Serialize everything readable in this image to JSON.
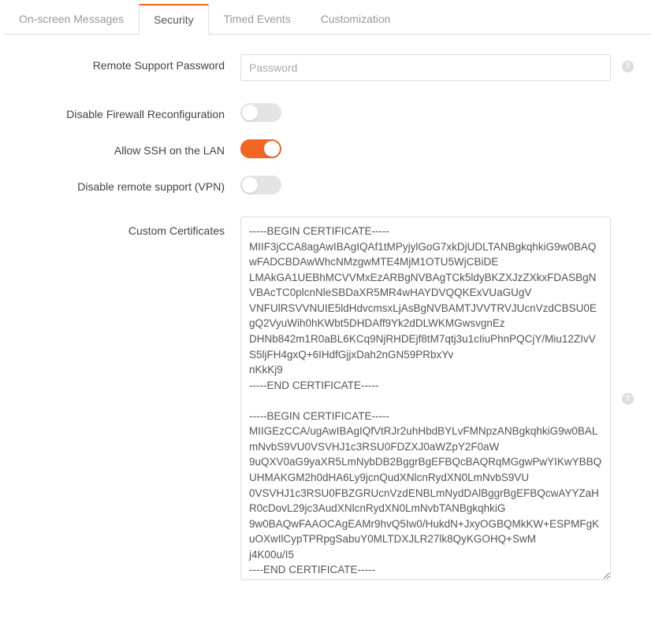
{
  "tabs": [
    {
      "label": "On-screen Messages",
      "active": false
    },
    {
      "label": "Security",
      "active": true
    },
    {
      "label": "Timed Events",
      "active": false
    },
    {
      "label": "Customization",
      "active": false
    }
  ],
  "fields": {
    "remote_password": {
      "label": "Remote Support Password",
      "placeholder": "Password",
      "value": ""
    },
    "disable_firewall": {
      "label": "Disable Firewall Reconfiguration",
      "on": false
    },
    "allow_ssh": {
      "label": "Allow SSH on the LAN",
      "on": true
    },
    "disable_vpn": {
      "label": "Disable remote support (VPN)",
      "on": false
    },
    "custom_certs": {
      "label": "Custom Certificates",
      "value": "-----BEGIN CERTIFICATE-----\nMIIF3jCCA8agAwIBAgIQAf1tMPyjylGoG7xkDjUDLTANBgkqhkiG9w0BAQwFADCBDAwWhcNMzgwMTE4MjM1OTU5WjCBiDE\nLMAkGA1UEBhMCVVMxEzARBgNVBAgTCk5ldyBKZXJzZXkxFDASBgNVBAcTC0plcnNleSBDaXR5MR4wHAYDVQQKExVUaGUgV\nVNFUlRSVVNUIE5ldHdvcmsxLjAsBgNVBAMTJVVTRVJUcnVzdCBSU0EgQ2VyuWih0hKWbt5DHDAff9Yk2dDLWKMGwsvgnEz\nDHNb842m1R0aBL6KCq9NjRHDEjf8tM7qtj3u1cIiuPhnPQCjY/Miu12ZIvVS5ljFH4gxQ+6IHdfGjjxDah2nGN59PRbxYv\nnKkKj9\n-----END CERTIFICATE-----\n\n-----BEGIN CERTIFICATE-----\nMIIGEzCCA/ugAwIBAgIQfVtRJr2uhHbdBYLvFMNpzANBgkqhkiG9w0BALmNvbS9VU0VSVHJ1c3RSU0FDZXJ0aWZpY2F0aW\n9uQXV0aG9yaXR5LmNybDB2BggrBgEFBQcBAQRqMGgwPwYIKwYBBQUHMAKGM2h0dHA6Ly9jcnQudXNlcnRydXN0LmNvbS9VU\n0VSVHJ1c3RSU0FBZGRUcnVzdENBLmNydDAlBggrBgEFBQcwAYYZaHR0cDovL29jc3AudXNlcnRydXN0LmNvbTANBgkqhkiG\n9w0BAQwFAAOCAgEAMr9hvQ5Iw0/HukdN+JxyOGBQMkKW+ESPMFgKuOXwIlCypTPRpgSabuY0MLTDXJLR27lk8QyKGOHQ+SwM\nj4K00u/I5\n----END CERTIFICATE-----"
    }
  },
  "help_glyph": "?"
}
